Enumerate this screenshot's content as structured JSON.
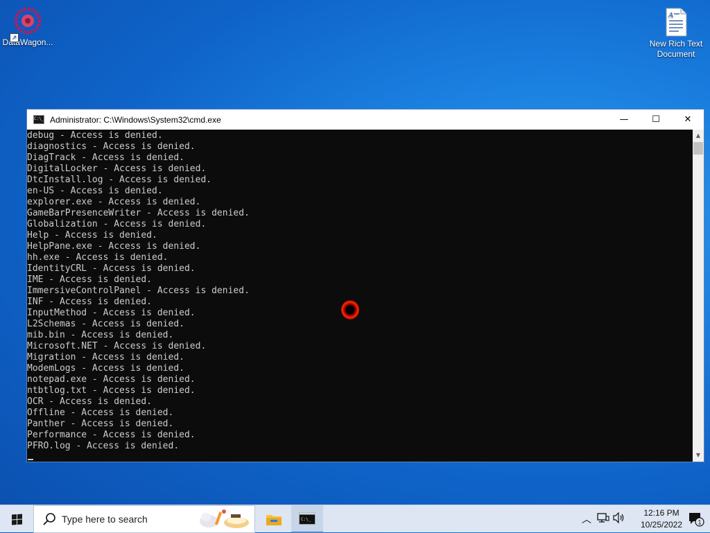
{
  "desktop": {
    "icons": [
      {
        "label": "DataWagon..."
      },
      {
        "label_line1": "New Rich Text",
        "label_line2": "Document"
      }
    ]
  },
  "window": {
    "title": "Administrator:  C:\\Windows\\System32\\cmd.exe",
    "minimize_glyph": "—",
    "maximize_glyph": "☐",
    "close_glyph": "✕"
  },
  "console_lines": [
    "debug - Access is denied.",
    "diagnostics - Access is denied.",
    "DiagTrack - Access is denied.",
    "DigitalLocker - Access is denied.",
    "DtcInstall.log - Access is denied.",
    "en-US - Access is denied.",
    "explorer.exe - Access is denied.",
    "GameBarPresenceWriter - Access is denied.",
    "Globalization - Access is denied.",
    "Help - Access is denied.",
    "HelpPane.exe - Access is denied.",
    "hh.exe - Access is denied.",
    "IdentityCRL - Access is denied.",
    "IME - Access is denied.",
    "ImmersiveControlPanel - Access is denied.",
    "INF - Access is denied.",
    "InputMethod - Access is denied.",
    "L2Schemas - Access is denied.",
    "mib.bin - Access is denied.",
    "Microsoft.NET - Access is denied.",
    "Migration - Access is denied.",
    "ModemLogs - Access is denied.",
    "notepad.exe - Access is denied.",
    "ntbtlog.txt - Access is denied.",
    "OCR - Access is denied.",
    "Offline - Access is denied.",
    "Panther - Access is denied.",
    "Performance - Access is denied.",
    "PFRO.log - Access is denied."
  ],
  "taskbar": {
    "search_placeholder": "Type here to search",
    "clock_time": "12:16 PM",
    "clock_date": "10/25/2022",
    "notification_count": "1"
  },
  "icons": {
    "start": "windows-logo-icon",
    "search": "search-icon",
    "explorer": "folder-icon",
    "cmd": "command-prompt-icon",
    "tray_chevron": "chevron-up-icon",
    "network": "network-icon",
    "volume": "volume-icon",
    "notifications": "notification-icon"
  },
  "colors": {
    "console_bg": "#0c0c0c",
    "console_text": "#cccccc",
    "taskbar_bg": "#dde6f2",
    "desktop_accent": "#1a7fe0"
  }
}
